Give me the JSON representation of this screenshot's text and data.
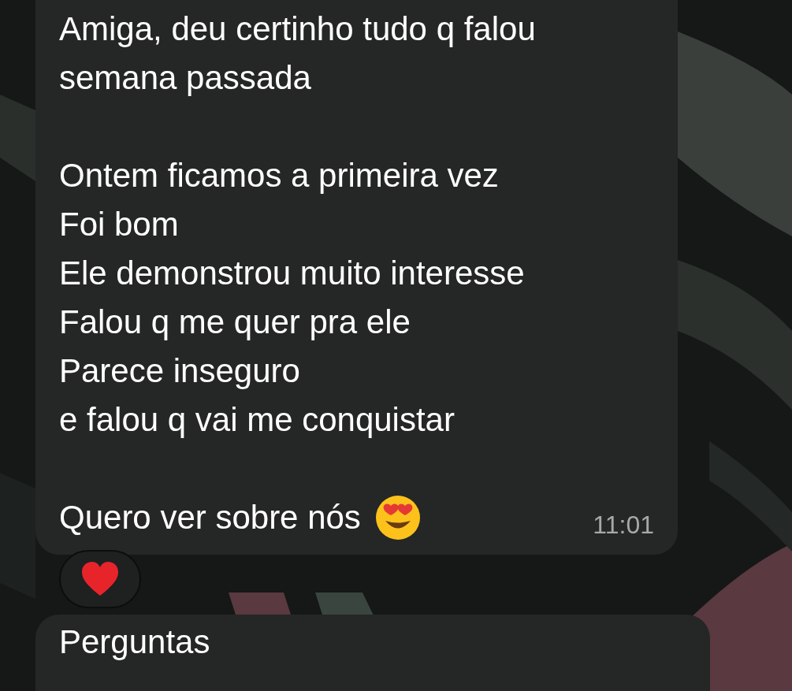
{
  "message": {
    "paragraphs": [
      [
        "Amiga, deu certinho tudo q falou semana passada"
      ],
      [
        "Ontem ficamos a primeira vez",
        "Foi bom",
        "Ele demonstrou muito interesse",
        "Falou q me quer pra ele",
        "Parece inseguro",
        "e falou q vai me conquistar"
      ],
      [
        "Quero ver sobre nós"
      ]
    ],
    "time": "11:01",
    "reaction": {
      "kind": "heart"
    }
  },
  "next_message": {
    "text": "Perguntas"
  }
}
